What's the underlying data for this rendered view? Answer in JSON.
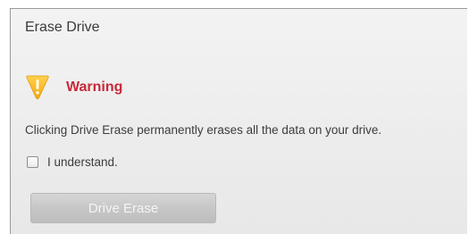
{
  "dialog": {
    "title": "Erase Drive",
    "warning": {
      "icon": "warning-icon",
      "label": "Warning",
      "label_color": "#c8283a",
      "icon_color": "#f5b51b"
    },
    "message": "Clicking Drive Erase permanently erases all the data on your drive.",
    "acknowledge": {
      "label": "I understand.",
      "checked": false
    },
    "erase_button": {
      "label": "Drive Erase",
      "enabled": false
    }
  }
}
